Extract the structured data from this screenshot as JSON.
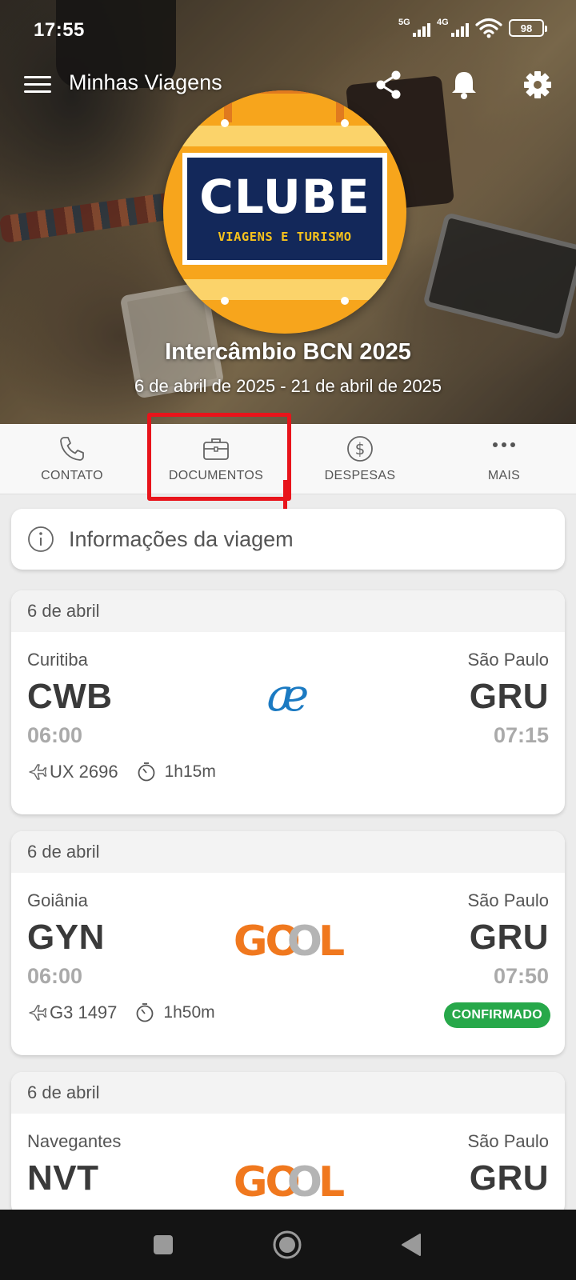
{
  "status_bar": {
    "time": "17:55",
    "network1": "5G",
    "network2": "4G",
    "battery": "98"
  },
  "app_bar": {
    "title": "Minhas Viagens",
    "icons": [
      "menu-icon",
      "share-icon",
      "bell-icon",
      "gear-icon"
    ]
  },
  "logo": {
    "main": "CLUBE",
    "sub": "VIAGENS E TURISMO"
  },
  "trip": {
    "title": "Intercâmbio BCN 2025",
    "dates": "6 de abril de 2025 - 21 de abril de 2025"
  },
  "tabs": [
    {
      "label": "CONTATO",
      "icon": "phone-icon"
    },
    {
      "label": "DOCUMENTOS",
      "icon": "briefcase-icon"
    },
    {
      "label": "DESPESAS",
      "icon": "dollar-icon"
    },
    {
      "label": "MAIS",
      "icon": "more-icon"
    }
  ],
  "info": {
    "label": "Informações da viagem"
  },
  "flights": [
    {
      "date": "6 de abril",
      "from_city": "Curitiba",
      "from_code": "CWB",
      "from_time": "06:00",
      "to_city": "São Paulo",
      "to_code": "GRU",
      "to_time": "07:15",
      "flight_number": "UX 2696",
      "duration": "1h15m",
      "airline_logo": "æ"
    },
    {
      "date": "6 de abril",
      "from_city": "Goiânia",
      "from_code": "GYN",
      "from_time": "06:00",
      "to_city": "São Paulo",
      "to_code": "GRU",
      "to_time": "07:50",
      "flight_number": "G3 1497",
      "duration": "1h50m",
      "airline_logo": "GOL",
      "status": "CONFIRMADO"
    },
    {
      "date": "6 de abril",
      "from_city": "Navegantes",
      "from_code": "NVT",
      "to_city": "São Paulo",
      "to_code": "GRU",
      "airline_logo": "GOL"
    }
  ],
  "colors": {
    "highlight": "#e8141b",
    "confirmed": "#27a84a",
    "gol_orange": "#f0781e",
    "aireuropa_blue": "#1b7ac2",
    "logo_orange": "#f7a51c",
    "logo_navy": "#13285a"
  }
}
